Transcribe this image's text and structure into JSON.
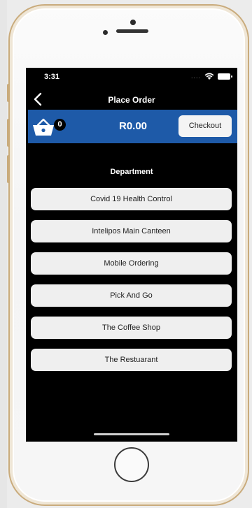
{
  "status": {
    "time": "3:31",
    "signal": "...."
  },
  "nav": {
    "title": "Place Order"
  },
  "cart": {
    "count": "0",
    "total": "R0.00",
    "checkout_label": "Checkout",
    "accent_color": "#1e5aa8"
  },
  "department": {
    "title": "Department",
    "items": [
      {
        "label": "Covid 19 Health Control"
      },
      {
        "label": "Intelipos Main Canteen"
      },
      {
        "label": "Mobile Ordering"
      },
      {
        "label": "Pick And Go"
      },
      {
        "label": "The Coffee Shop"
      },
      {
        "label": "The Restuarant"
      }
    ]
  },
  "icons": [
    "back-chevron-icon",
    "basket-icon",
    "wifi-icon",
    "battery-icon"
  ]
}
